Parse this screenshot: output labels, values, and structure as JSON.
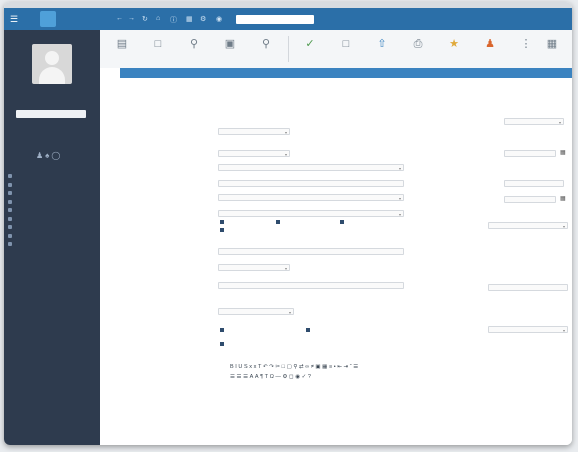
{
  "topbar": {
    "menu_icon": "hamburger-icon",
    "quick_icons": [
      "back-icon",
      "forward-icon",
      "refresh-icon",
      "home-icon",
      "info-icon",
      "calendar-icon",
      "settings-icon"
    ],
    "search_placeholder": ""
  },
  "sidebar": {
    "user_name": "",
    "user_role": "",
    "filter_value": "",
    "filter_caption": "",
    "nav": [
      "",
      "",
      "",
      "",
      "",
      "",
      "",
      "",
      ""
    ]
  },
  "ribbon": {
    "buttons": [
      "",
      "",
      "",
      "",
      "",
      "",
      "",
      "",
      "",
      "",
      "",
      "",
      ""
    ]
  },
  "tabs": [
    "",
    "",
    "",
    "",
    "",
    "",
    "",
    "",
    ""
  ],
  "content": {
    "title": "",
    "warning": "",
    "labels_left": [
      "",
      "",
      "",
      "",
      "",
      "",
      "",
      "",
      "",
      "",
      "",
      "",
      "",
      "",
      "",
      "",
      ""
    ],
    "labels_right": [
      "",
      "",
      "",
      "",
      "",
      "",
      ""
    ],
    "fields": {
      "f1": "",
      "f2": "",
      "f3": "",
      "f4": "",
      "f5": "",
      "f6": "",
      "f7": "",
      "f8": "",
      "f9": "",
      "f10": "",
      "f11": "",
      "f12": ""
    },
    "right_top_select": "",
    "right_top_note": "",
    "chips": [
      "",
      "",
      "",
      "",
      "",
      "",
      ""
    ]
  },
  "colors": {
    "topbar": "#2b6fa8",
    "sidebar": "#2e3b4e",
    "tabs": "#3b83c0",
    "required_label": "#c73d3d"
  }
}
